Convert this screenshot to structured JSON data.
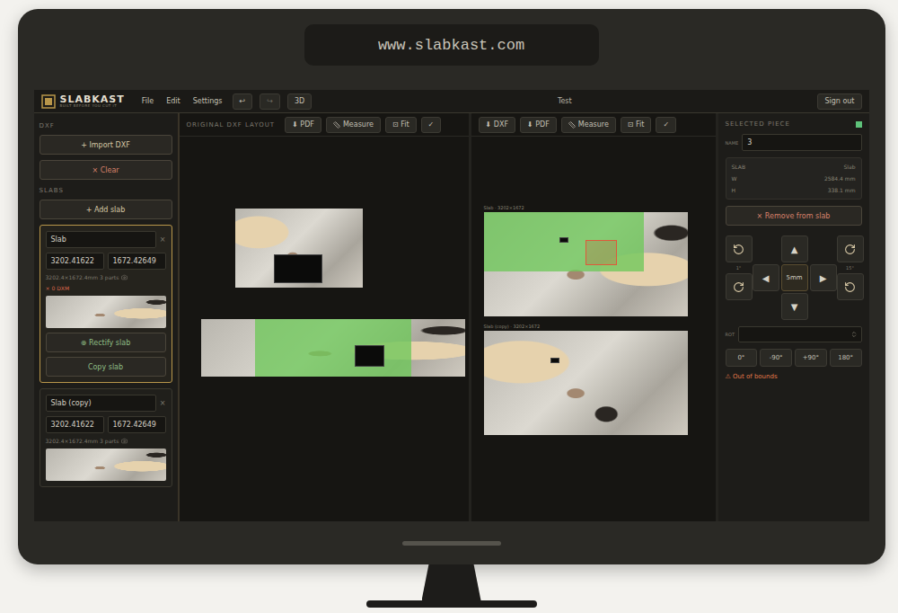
{
  "url": "www.slabkast.com",
  "topbar": {
    "logo": "SLABKAST",
    "tagline": "BUILT BEFORE YOU CUT IT",
    "menu": [
      "File",
      "Edit",
      "Settings"
    ],
    "undo": "↩",
    "redo": "↪",
    "view_button": "3D",
    "project": "Test",
    "sign_out": "Sign out"
  },
  "sidebar": {
    "dxf_label": "DXF",
    "import_button": "+ Import DXF",
    "clear_button": "× Clear",
    "slabs_label": "SLABS",
    "add_button": "+ Add slab",
    "slabs": [
      {
        "name": "Slab",
        "close": "×",
        "width": "3202.41622",
        "height": "1672.42649",
        "meta": "3202.4×1672.4mm 3 parts",
        "warning": "× 0 DXM",
        "selected": true,
        "actions": [
          "⊕ Rectify slab",
          "Copy slab"
        ]
      },
      {
        "name": "Slab (copy)",
        "close": "×",
        "width": "3202.41622",
        "height": "1672.42649",
        "meta": "3202.4×1672.4mm 3 parts",
        "warning": "",
        "selected": false,
        "actions": []
      }
    ]
  },
  "original_panel": {
    "title": "ORIGINAL DXF LAYOUT",
    "tools": [
      {
        "label": "⬇ PDF",
        "kind": "plain"
      },
      {
        "label": "Measure",
        "kind": "measure"
      },
      {
        "label": "⊡ Fit",
        "kind": "plain"
      },
      {
        "label": "✓",
        "kind": "plain"
      }
    ],
    "pieces": [
      {
        "selected": false
      },
      {
        "selected": true
      }
    ]
  },
  "nest_panel": {
    "tools": [
      {
        "label": "⬇ DXF",
        "kind": "plain"
      },
      {
        "label": "⬇ PDF",
        "kind": "plain"
      },
      {
        "label": "Measure",
        "kind": "measure"
      },
      {
        "label": "⊡ Fit",
        "kind": "plain"
      },
      {
        "label": "✓",
        "kind": "plain"
      }
    ],
    "slabs": [
      {
        "label": "Slab · 3202×1672",
        "selected": true
      },
      {
        "label": "Slab (copy) · 3202×1672",
        "selected": false
      }
    ]
  },
  "selected_piece": {
    "title": "SELECTED PIECE",
    "status_color": "#5ec27a",
    "name_label": "NAME",
    "name": "3",
    "info": [
      {
        "key": "SLAB",
        "value": "Slab"
      },
      {
        "key": "W",
        "value": "2584.4 mm"
      },
      {
        "key": "H",
        "value": "338.1 mm"
      }
    ],
    "remove_button": "× Remove from slab",
    "rotate": {
      "fine_label": "1°",
      "coarse_label": "15°"
    },
    "nudge": {
      "up": "▲",
      "left": "◀",
      "step": "5mm",
      "right": "▶",
      "down": "▼"
    },
    "rot_label": "ROT",
    "rot_buttons": [
      "0°",
      "-90°",
      "+90°",
      "180°"
    ],
    "warning": "⚠ Out of bounds"
  }
}
